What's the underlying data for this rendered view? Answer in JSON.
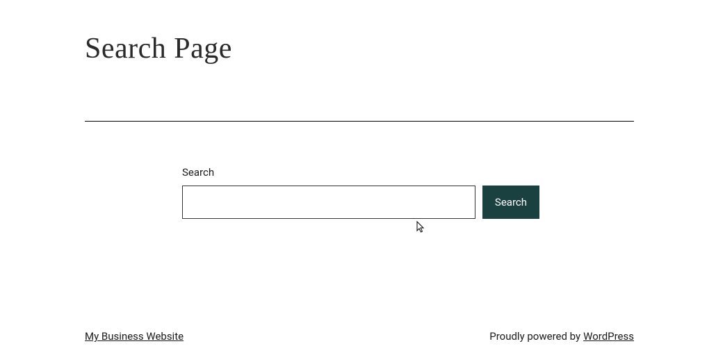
{
  "page": {
    "title": "Search Page"
  },
  "search": {
    "label": "Search",
    "input_value": "",
    "button_label": "Search"
  },
  "footer": {
    "site_link_text": "My Business Website",
    "powered_by_prefix": "Proudly powered by ",
    "powered_by_link": "WordPress"
  },
  "colors": {
    "button_bg": "#1b4040",
    "text": "#1a1a1a"
  }
}
